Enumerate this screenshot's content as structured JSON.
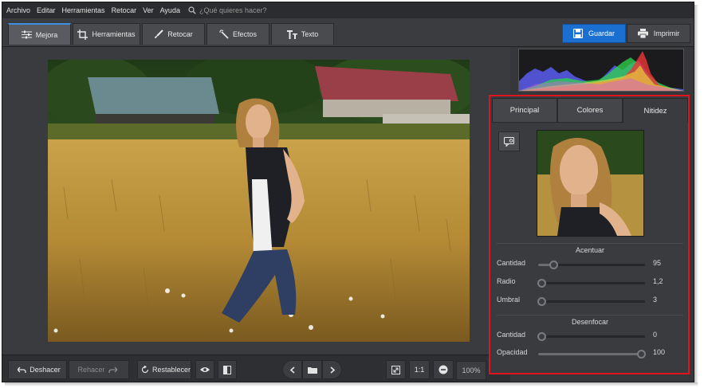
{
  "menu": {
    "items": [
      "Archivo",
      "Editar",
      "Herramientas",
      "Retocar",
      "Ver",
      "Ayuda"
    ],
    "search_placeholder": "¿Qué quieres hacer?"
  },
  "toolbar": {
    "tabs": [
      {
        "label": "Mejora",
        "icon": "sliders-icon",
        "active": true
      },
      {
        "label": "Herramientas",
        "icon": "crop-icon",
        "active": false
      },
      {
        "label": "Retocar",
        "icon": "brush-icon",
        "active": false
      },
      {
        "label": "Efectos",
        "icon": "magic-wand-icon",
        "active": false
      },
      {
        "label": "Texto",
        "icon": "text-icon",
        "active": false
      }
    ],
    "save_label": "Guardar",
    "print_label": "Imprimir"
  },
  "bottombar": {
    "undo_label": "Deshacer",
    "redo_label": "Rehacer",
    "reset_label": "Restablecer",
    "actual_size_label": "1:1",
    "zoom_value": "100%"
  },
  "panel": {
    "tabs": [
      "Principal",
      "Colores",
      "Nitidez"
    ],
    "active_tab": "Nitidez",
    "sharpen": {
      "title": "Acentuar",
      "amount": {
        "label": "Cantidad",
        "value": "95",
        "level": 0.14
      },
      "radius": {
        "label": "Radio",
        "value": "1,2",
        "level": 0.0
      },
      "threshold": {
        "label": "Umbral",
        "value": "3",
        "level": 0.0
      }
    },
    "blur": {
      "title": "Desenfocar",
      "amount": {
        "label": "Cantidad",
        "value": "0",
        "level": 0.0
      },
      "opacity": {
        "label": "Opacidad",
        "value": "100",
        "level": 1.0
      }
    }
  },
  "colors": {
    "accent_blue": "#1a6fd0",
    "highlight_red": "#e0141e",
    "background": "#343538"
  }
}
